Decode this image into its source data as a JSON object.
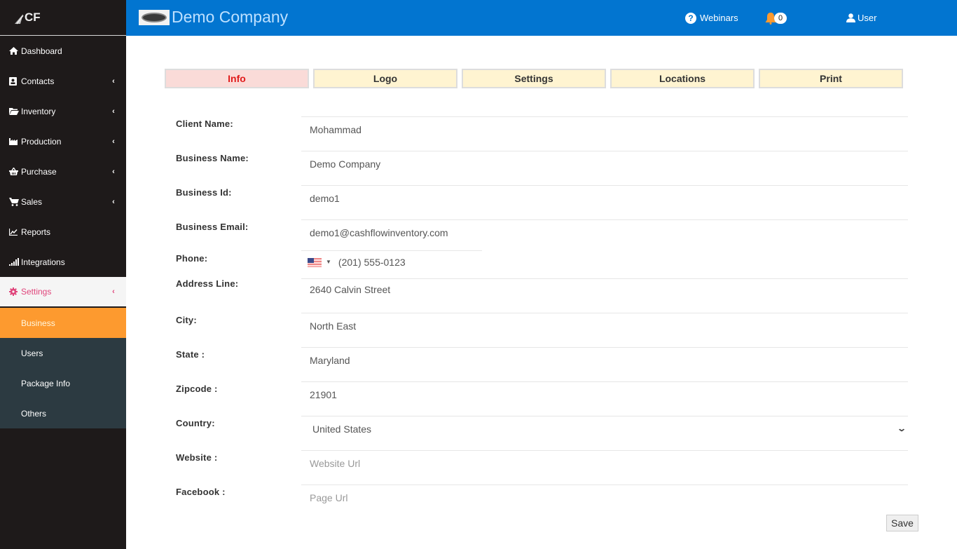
{
  "app": {
    "logo_text": "CF",
    "company_name": "Demo Company"
  },
  "topbar": {
    "webinars_label": "Webinars",
    "notification_count": "0",
    "user_label": "User"
  },
  "sidebar": {
    "items": [
      {
        "label": "Dashboard",
        "icon": "home-icon",
        "has_submenu": false
      },
      {
        "label": "Contacts",
        "icon": "contact-card-icon",
        "has_submenu": true
      },
      {
        "label": "Inventory",
        "icon": "folder-open-icon",
        "has_submenu": true
      },
      {
        "label": "Production",
        "icon": "factory-icon",
        "has_submenu": true
      },
      {
        "label": "Purchase",
        "icon": "basket-icon",
        "has_submenu": true
      },
      {
        "label": "Sales",
        "icon": "cart-icon",
        "has_submenu": true
      },
      {
        "label": "Reports",
        "icon": "line-chart-icon",
        "has_submenu": false
      },
      {
        "label": "Integrations",
        "icon": "signal-bars-icon",
        "has_submenu": false
      },
      {
        "label": "Settings",
        "icon": "gear-icon",
        "has_submenu": true,
        "active": true
      }
    ],
    "chevron": "‹",
    "settings_submenu": [
      {
        "label": "Business",
        "active": true
      },
      {
        "label": "Users"
      },
      {
        "label": "Package Info"
      },
      {
        "label": "Others"
      }
    ]
  },
  "tabs": [
    {
      "label": "Info",
      "active": true
    },
    {
      "label": "Logo"
    },
    {
      "label": "Settings"
    },
    {
      "label": "Locations"
    },
    {
      "label": "Print"
    }
  ],
  "form": {
    "client_name": {
      "label": "Client Name:",
      "value": "Mohammad"
    },
    "business_name": {
      "label": "Business Name:",
      "value": "Demo Company"
    },
    "business_id": {
      "label": "Business Id:",
      "value": "demo1"
    },
    "business_email": {
      "label": "Business Email:",
      "value": "demo1@cashflowinventory.com"
    },
    "phone": {
      "label": "Phone:",
      "country": "US",
      "value": "(201) 555-0123"
    },
    "address": {
      "label": "Address Line:",
      "value": "2640  Calvin Street"
    },
    "city": {
      "label": "City:",
      "value": "North East"
    },
    "state": {
      "label": "State :",
      "value": "Maryland"
    },
    "zipcode": {
      "label": "Zipcode :",
      "value": "21901"
    },
    "country": {
      "label": "Country:",
      "value": "United States"
    },
    "website": {
      "label": "Website :",
      "value": "",
      "placeholder": "Website Url"
    },
    "facebook": {
      "label": "Facebook :",
      "value": "",
      "placeholder": "Page Url"
    },
    "save_label": "Save"
  },
  "colors": {
    "topbar": "#0275d0",
    "sidebar": "#1e1a1a",
    "submenu": "#2c3a41",
    "active_sub": "#fd9a2f",
    "settings_active": "#e0457b",
    "tab_active_bg": "#fadbd8",
    "tab_bg": "#fff4d1"
  }
}
